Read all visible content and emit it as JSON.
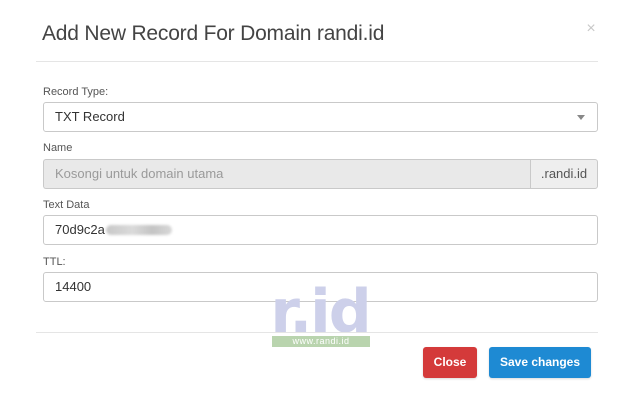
{
  "modal": {
    "title": "Add New Record For Domain randi.id",
    "close_icon": "×"
  },
  "form": {
    "record_type": {
      "label": "Record Type:",
      "value": "TXT Record"
    },
    "name": {
      "label": "Name",
      "placeholder": "Kosongi untuk domain utama",
      "suffix": ".randi.id"
    },
    "text_data": {
      "label": "Text Data",
      "value_visible": "70d9c2a"
    },
    "ttl": {
      "label": "TTL:",
      "value": "14400"
    }
  },
  "watermark": {
    "logo": "r.id",
    "url": "www.randi.id"
  },
  "footer": {
    "close_label": "Close",
    "save_label": "Save changes"
  },
  "colors": {
    "danger": "#d43a3a",
    "primary": "#1e8ad3"
  }
}
